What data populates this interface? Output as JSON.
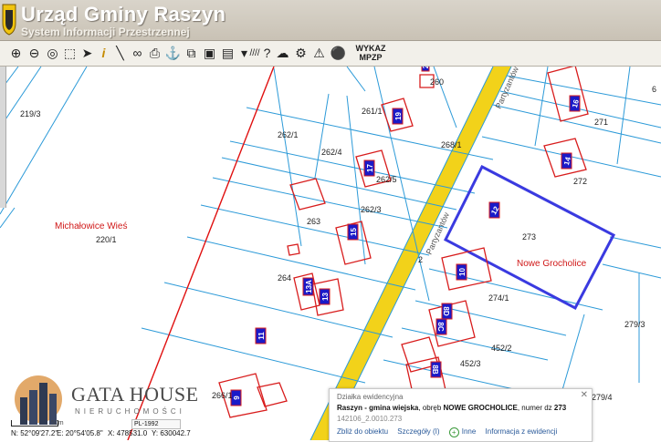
{
  "header": {
    "title": "Urząd Gminy Raszyn",
    "subtitle": "System Informacji Przestrzennej"
  },
  "toolbar": {
    "tools": [
      {
        "icon": "zoom-in-icon",
        "glyph": "⊕"
      },
      {
        "icon": "zoom-out-icon",
        "glyph": "⊖"
      },
      {
        "icon": "zoom-extent-icon",
        "glyph": "◎"
      },
      {
        "icon": "zoom-window-icon",
        "glyph": "⬚"
      },
      {
        "icon": "select-icon",
        "glyph": "➤"
      },
      {
        "icon": "info-icon",
        "glyph": "i"
      },
      {
        "icon": "measure-icon",
        "glyph": "╲"
      },
      {
        "icon": "link-icon",
        "glyph": "∞"
      },
      {
        "icon": "print-icon",
        "glyph": "⎙"
      },
      {
        "icon": "anchor-icon",
        "glyph": "⚓"
      },
      {
        "icon": "export-icon",
        "glyph": "⧉"
      },
      {
        "icon": "layers-icon",
        "glyph": "▣"
      },
      {
        "icon": "table-icon",
        "glyph": "▤"
      },
      {
        "icon": "comment-icon",
        "glyph": "▾"
      },
      {
        "icon": "hatch-icon",
        "glyph": "////"
      },
      {
        "icon": "help-icon",
        "glyph": "?"
      },
      {
        "icon": "cloud-icon",
        "glyph": "☁"
      },
      {
        "icon": "settings-icon",
        "glyph": "⚙"
      },
      {
        "icon": "warning-icon",
        "glyph": "⚠"
      },
      {
        "icon": "share-icon",
        "glyph": "⚫"
      }
    ],
    "mpzp_line1": "WYKAZ",
    "mpzp_line2": "MPZP"
  },
  "map": {
    "region_labels": [
      "Michałowice Wieś",
      "Nowe Grocholice"
    ],
    "street": "Partyzantów",
    "parcels": [
      "219/3",
      "220/1",
      "262/1",
      "262/4",
      "262/5",
      "262/3",
      "263",
      "264",
      "268/1",
      "260",
      "261/1",
      "271",
      "272",
      "273",
      "274/1",
      "279/3",
      "452/2",
      "452/3",
      "266/1",
      "279/4",
      "2",
      "6"
    ],
    "house_numbers": [
      "19",
      "17",
      "15",
      "13A",
      "13",
      "11",
      "9",
      "12",
      "10",
      "8D",
      "8C",
      "8B",
      "16",
      "14",
      "2"
    ]
  },
  "branding": {
    "name": "GATA HOUSE",
    "tagline": "NIERUCHOMOŚCI"
  },
  "status": {
    "scale": "50m",
    "crs": "PL-1992",
    "lat": "N: 52°09'27.2\"",
    "lon": "E: 20°54'05.8\"",
    "x": "X: 478531.0",
    "y": "Y: 630042.7"
  },
  "popup": {
    "title": "Działka ewidencyjna",
    "desc_prefix": "Raszyn - gmina wiejska",
    "desc_mid1": ", obręb ",
    "obreb": "NOWE GROCHOLICE",
    "desc_mid2": ", numer dz ",
    "parcel_no": "273",
    "id": "142106_2.0010.273",
    "links": [
      "Zbliż do obiektu",
      "Szczegóły (I)",
      "Inne",
      "Informacja z ewidencji"
    ]
  },
  "colors": {
    "parcel_line": "#2c9ad8",
    "building": "#d81c1c",
    "house_number_bg": "#1a1ac8",
    "highlight": "#3a3ae0",
    "road": "#f2d21a",
    "boundary": "#e01010"
  }
}
